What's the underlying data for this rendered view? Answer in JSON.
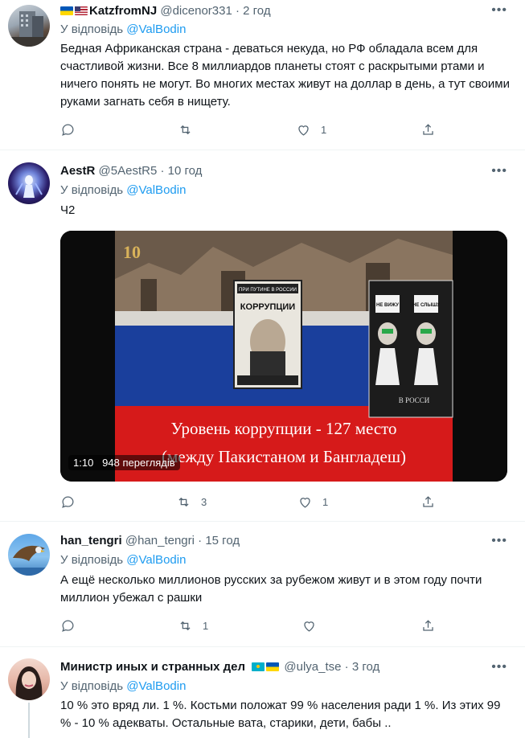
{
  "tweets": [
    {
      "name": "KatzfromNJ",
      "flags": [
        "ukraine-flag-icon",
        "usa-flag-icon"
      ],
      "handle": "@dicenor331",
      "dot": "·",
      "time": "2 год",
      "reply_prefix": "У відповідь",
      "reply_to": "@ValBodin",
      "text": "Бедная Африканская страна - деваться некуда, но РФ обладала всем для счастливой жизни. Все 8 миллиардов планеты стоят с раскрытыми ртами и ничего понять не могут. Во многих местах живут на доллар в день, а тут своими руками загнать себя в нищету.",
      "retweets": "",
      "likes": "1"
    },
    {
      "name": "AestR",
      "handle": "@5AestR5",
      "dot": "·",
      "time": "10 год",
      "reply_prefix": "У відповідь",
      "reply_to": "@ValBodin",
      "text": "Ч2",
      "video": {
        "duration": "1:10",
        "views": "948 переглядів",
        "overlay_line1": "Уровень коррупции - 127 место",
        "overlay_line2": "(между Пакистаном и Бангладеш)",
        "book_title": "КОРРУПЦИИ",
        "book_top": "ПРИ ПУТИНЕ В РОССИИ",
        "sign1": "НЕ ВИЖУ",
        "sign2": "НЕ СЛЫШУ",
        "sign3": "В РОССИ",
        "number": "10"
      },
      "retweets": "3",
      "likes": "1"
    },
    {
      "name": "han_tengri",
      "handle": "@han_tengri",
      "dot": "·",
      "time": "15 год",
      "reply_prefix": "У відповідь",
      "reply_to": "@ValBodin",
      "text": "А ещё несколько миллионов русских за рубежом живут и в этом году почти миллион убежал с рашки",
      "retweets": "1",
      "likes": ""
    },
    {
      "name": "Министр иных и странных дел",
      "flags": [
        "kazakhstan-flag-icon",
        "ukraine-flag-icon"
      ],
      "handle": "@ulya_tse",
      "dot": "·",
      "time": "3 год",
      "reply_prefix": "У відповідь",
      "reply_to": "@ValBodin",
      "text": "10 % это вряд ли. 1 %. Костьми положат 99 % населения ради 1 %. Из этих 99 % - 10 % адекваты. Остальные вата, старики, дети, бабы .."
    }
  ],
  "more_label": "•••",
  "colors": {
    "accent": "#1d9bf0",
    "muted": "#536471",
    "text": "#0f1419",
    "divider": "#eff3f4"
  }
}
